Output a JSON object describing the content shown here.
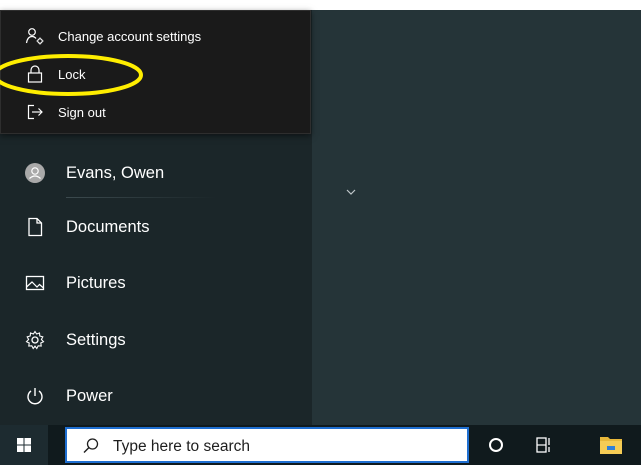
{
  "power_menu": {
    "items": [
      {
        "label": "Change account settings",
        "icon": "account-settings-icon"
      },
      {
        "label": "Lock",
        "icon": "lock-icon"
      },
      {
        "label": "Sign out",
        "icon": "sign-out-icon"
      }
    ]
  },
  "start_rail": {
    "user": {
      "label": "Evans, Owen",
      "icon": "user-avatar-icon"
    },
    "items": [
      {
        "label": "Documents",
        "icon": "document-icon"
      },
      {
        "label": "Pictures",
        "icon": "pictures-icon"
      },
      {
        "label": "Settings",
        "icon": "gear-icon"
      },
      {
        "label": "Power",
        "icon": "power-icon"
      }
    ]
  },
  "taskbar": {
    "search_placeholder": "Type here to search",
    "buttons": [
      "windows-logo-icon",
      "cortana-icon",
      "task-view-icon",
      "file-explorer-icon"
    ]
  },
  "colors": {
    "annotation": "#ffee00",
    "search_border": "#1f6fd1",
    "desktop": "#243236",
    "menu": "#1a1a1a"
  }
}
